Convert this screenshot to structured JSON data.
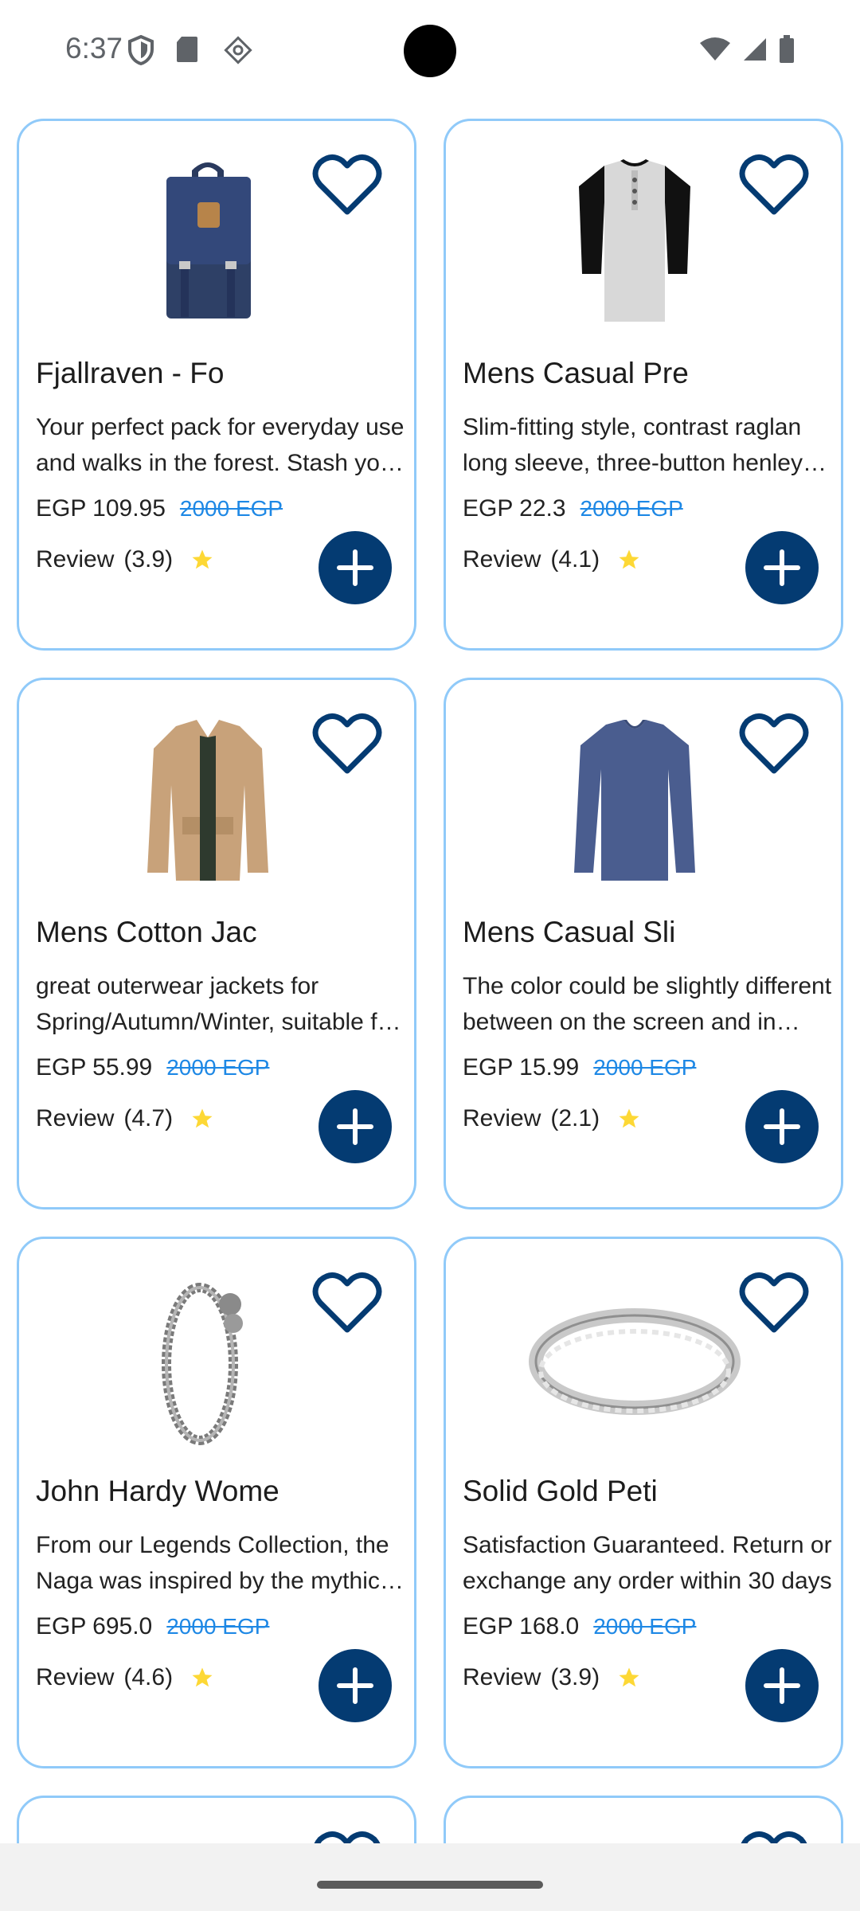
{
  "status_bar": {
    "time": "6:37"
  },
  "colors": {
    "accent": "#043b72",
    "card_border": "#90caf9",
    "old_price": "#1e88e5",
    "star": "#fdd835"
  },
  "products": [
    {
      "title": "Fjallraven - Fo",
      "description": "Your perfect pack for everyday use and walks in the forest. Stash your laptop",
      "price": "EGP 109.95",
      "old_price": "2000 EGP",
      "review_label": "Review",
      "rating": "(3.9)",
      "image": "backpack"
    },
    {
      "title": "Mens Casual Pre",
      "description": "Slim-fitting style, contrast raglan long sleeve, three-button henley placket",
      "price": "EGP 22.3",
      "old_price": "2000 EGP",
      "review_label": "Review",
      "rating": "(4.1)",
      "image": "raglan-shirt"
    },
    {
      "title": "Mens Cotton Jac",
      "description": "great outerwear jackets for Spring/Autumn/Winter, suitable for many occasions",
      "price": "EGP 55.99",
      "old_price": "2000 EGP",
      "review_label": "Review",
      "rating": "(4.7)",
      "image": "jacket"
    },
    {
      "title": "Mens Casual Sli",
      "description": "The color could be slightly different between on the screen and in practice",
      "price": "EGP 15.99",
      "old_price": "2000 EGP",
      "review_label": "Review",
      "rating": "(2.1)",
      "image": "long-sleeve-shirt"
    },
    {
      "title": "John Hardy Wome",
      "description": "From our Legends Collection, the Naga was inspired by the mythical water dragon",
      "price": "EGP 695.0",
      "old_price": "2000 EGP",
      "review_label": "Review",
      "rating": "(4.6)",
      "image": "bracelet"
    },
    {
      "title": "Solid Gold Peti",
      "description": "Satisfaction Guaranteed. Return or exchange any order within 30 days",
      "price": "EGP 168.0",
      "old_price": "2000 EGP",
      "review_label": "Review",
      "rating": "(3.9)",
      "image": "ring"
    }
  ]
}
